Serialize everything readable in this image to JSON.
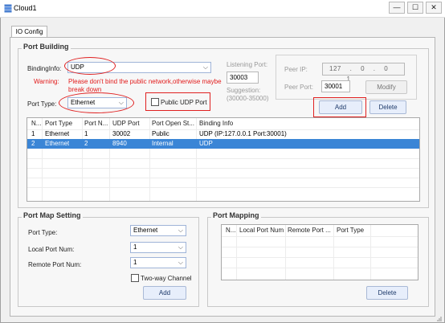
{
  "window": {
    "title": "Cloud1",
    "minimize_glyph": "—",
    "maximize_glyph": "☐",
    "close_glyph": "✕"
  },
  "tabs": [
    "IO Config"
  ],
  "port_building": {
    "title": "Port Building",
    "binding_info_label": "BindingInfo:",
    "binding_info_value": "UDP",
    "warning_label": "Warning:",
    "warning_text": "Please don't bind the public network,otherwise maybe break down",
    "port_type_label": "Port Type:",
    "port_type_value": "Ethernet",
    "public_udp_label": "Public UDP Port",
    "listening_port_label": "Listening Port:",
    "listening_port_value": "30003",
    "suggestion_label": "Suggestion:",
    "suggestion_range": "(30000-35000)",
    "peer_ip_label": "Peer IP:",
    "peer_ip_octets": [
      "127",
      "0",
      "0",
      "1"
    ],
    "peer_port_label": "Peer Port:",
    "peer_port_value": "30001",
    "modify_button": "Modify",
    "add_button": "Add",
    "delete_button": "Delete"
  },
  "port_table": {
    "columns": [
      "N...",
      "Port Type",
      "Port N...",
      "UDP Port",
      "Port Open St...",
      "Binding Info"
    ],
    "rows": [
      [
        "1",
        "Ethernet",
        "1",
        "30002",
        "Public",
        "UDP (IP:127.0.0.1 Port:30001)"
      ],
      [
        "2",
        "Ethernet",
        "2",
        "8940",
        "Internal",
        "UDP"
      ]
    ]
  },
  "port_map_setting": {
    "title": "Port Map Setting",
    "port_type_label": "Port Type:",
    "port_type_value": "Ethernet",
    "local_port_label": "Local Port Num:",
    "local_port_value": "1",
    "remote_port_label": "Remote Port Num:",
    "remote_port_value": "1",
    "two_way_label": "Two-way Channel",
    "add_button": "Add"
  },
  "port_mapping": {
    "title": "Port Mapping",
    "columns": [
      "N...",
      "Local Port Num",
      "Remote Port ...",
      "Port Type"
    ],
    "delete_button": "Delete"
  },
  "colors": {
    "annotation_red": "#e02020",
    "selection_blue": "#3a85d6",
    "warning_red": "#e21b1b"
  }
}
